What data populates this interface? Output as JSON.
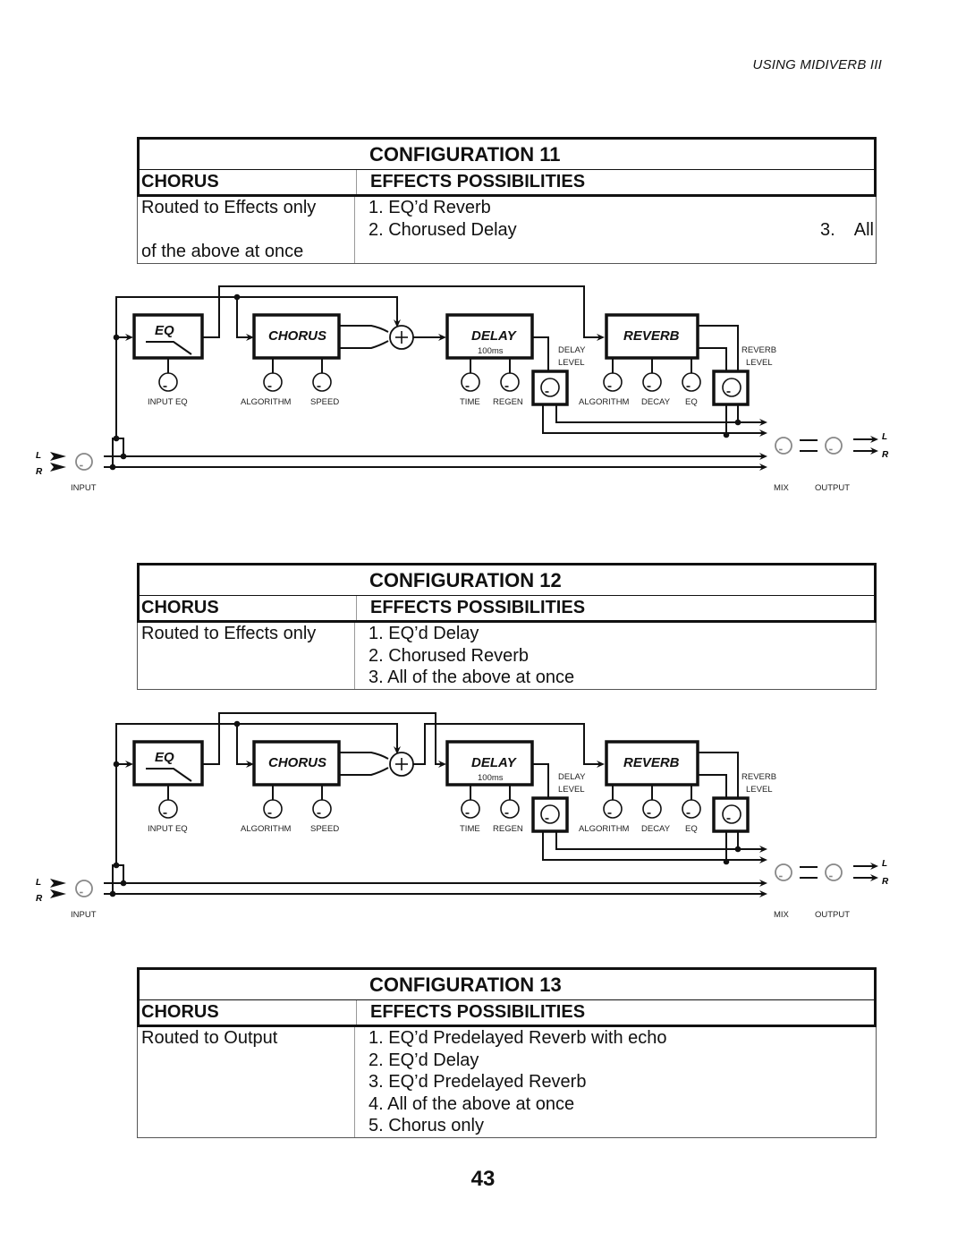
{
  "running_head": "USING MIDIVERB III",
  "page_number": "43",
  "configurations": [
    {
      "title": "CONFIGURATION 11",
      "col1_header": "CHORUS",
      "col2_header": "EFFECTS POSSIBILITIES",
      "chorus_routing": [
        "Routed to Effects only",
        "",
        "of the above at once"
      ],
      "possibilities": [
        "1. EQ’d Reverb",
        "2. Chorused Delay"
      ],
      "possibilities_overflow": "3.    All",
      "diagram": {
        "variant": "eq-to-reverb",
        "blocks": {
          "eq": "EQ",
          "chorus": "CHORUS",
          "delay": "DELAY",
          "delay_value": "100ms",
          "reverb": "REVERB"
        },
        "knob_labels": {
          "input_eq": "INPUT EQ",
          "algorithm": "ALGORITHM",
          "speed": "SPEED",
          "time": "TIME",
          "regen": "REGEN",
          "rev_algorithm": "ALGORITHM",
          "decay": "DECAY",
          "eq": "EQ"
        },
        "level_labels": {
          "delay_level_1": "DELAY",
          "delay_level_2": "LEVEL",
          "reverb_level_1": "REVERB",
          "reverb_level_2": "LEVEL"
        },
        "io_labels": {
          "input": "INPUT",
          "mix": "MIX",
          "output": "OUTPUT",
          "left": "L",
          "right": "R"
        }
      }
    },
    {
      "title": "CONFIGURATION 12",
      "col1_header": "CHORUS",
      "col2_header": "EFFECTS POSSIBILITIES",
      "chorus_routing": [
        "Routed to Effects only"
      ],
      "possibilities": [
        "1. EQ’d Delay",
        "2. Chorused Reverb",
        "3. All of the above at once"
      ],
      "diagram": {
        "variant": "eq-to-delay",
        "blocks": {
          "eq": "EQ",
          "chorus": "CHORUS",
          "delay": "DELAY",
          "delay_value": "100ms",
          "reverb": "REVERB"
        },
        "knob_labels": {
          "input_eq": "INPUT EQ",
          "algorithm": "ALGORITHM",
          "speed": "SPEED",
          "time": "TIME",
          "regen": "REGEN",
          "rev_algorithm": "ALGORITHM",
          "decay": "DECAY",
          "eq": "EQ"
        },
        "level_labels": {
          "delay_level_1": "DELAY",
          "delay_level_2": "LEVEL",
          "reverb_level_1": "REVERB",
          "reverb_level_2": "LEVEL"
        },
        "io_labels": {
          "input": "INPUT",
          "mix": "MIX",
          "output": "OUTPUT",
          "left": "L",
          "right": "R"
        }
      }
    },
    {
      "title": "CONFIGURATION 13",
      "col1_header": "CHORUS",
      "col2_header": "EFFECTS POSSIBILITIES",
      "chorus_routing": [
        "Routed to Output"
      ],
      "possibilities": [
        "1. EQ’d Predelayed Reverb with echo",
        "2. EQ’d Delay",
        "3. EQ’d Predelayed Reverb",
        "4. All of the above at once",
        "5. Chorus only"
      ]
    }
  ]
}
